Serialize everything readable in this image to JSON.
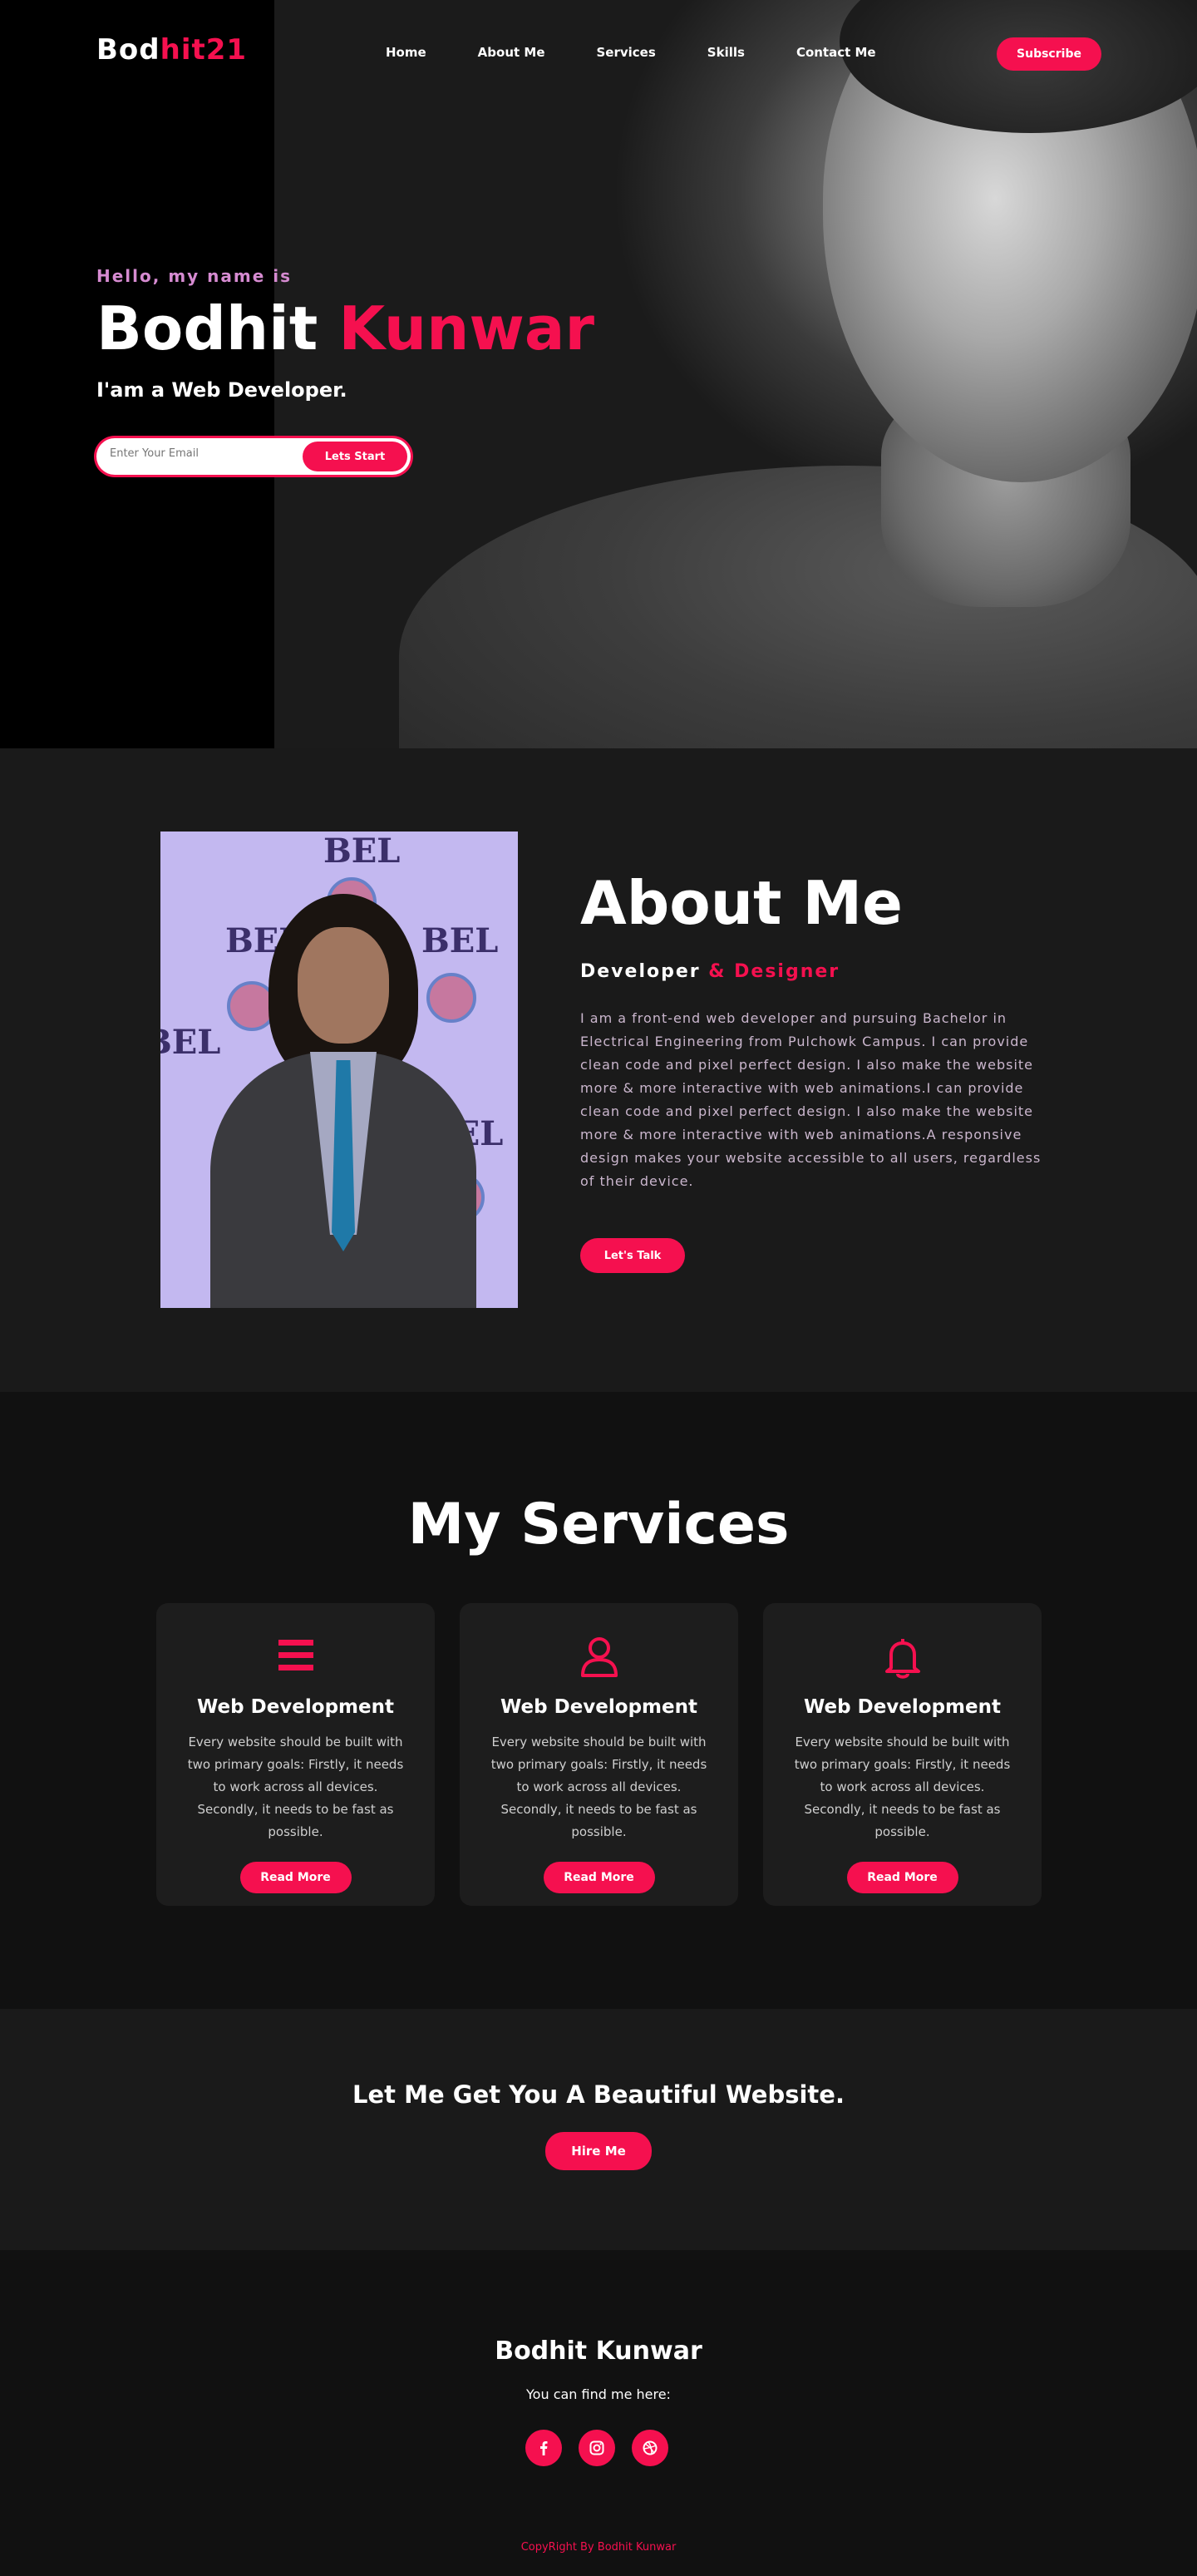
{
  "colors": {
    "accent": "#f5104f",
    "hello": "#d68bd1",
    "background": "#111111",
    "section_alt": "#1a1a1a"
  },
  "logo": {
    "prefix": "Bod",
    "accent": "hit21"
  },
  "nav": {
    "items": [
      "Home",
      "About Me",
      "Services",
      "Skills",
      "Contact Me"
    ],
    "subscribe_label": "Subscribe"
  },
  "hero": {
    "hello": "Hello, my name is",
    "first_name": "Bodhit",
    "last_name": "Kunwar",
    "tagline": "I'am a Web Developer.",
    "email_placeholder": "Enter Your Email",
    "start_label": "Lets Start"
  },
  "about": {
    "title": "About Me",
    "role_prefix": "Developer",
    "role_accent": "& Designer",
    "bio": "I am a front-end web developer and pursuing Bachelor in Electrical Engineering from Pulchowk Campus. I can provide clean code and pixel perfect design. I also make the website more & more interactive with web animations.I can provide clean code and pixel perfect design. I also make the website more & more interactive with web animations.A responsive design makes your website accessible to all users, regardless of their device.",
    "talk_label": "Let's Talk",
    "photo_banner": "BEL"
  },
  "services": {
    "title": "My Services",
    "cards": [
      {
        "icon": "menu-bars-icon",
        "title": "Web Development",
        "text": "Every website should be built with two primary goals: Firstly, it needs to work across all devices. Secondly, it needs to be fast as possible.",
        "button": "Read More"
      },
      {
        "icon": "user-icon",
        "title": "Web Development",
        "text": "Every website should be built with two primary goals: Firstly, it needs to work across all devices. Secondly, it needs to be fast as possible.",
        "button": "Read More"
      },
      {
        "icon": "bell-icon",
        "title": "Web Development",
        "text": "Every website should be built with two primary goals: Firstly, it needs to work across all devices. Secondly, it needs to be fast as possible.",
        "button": "Read More"
      }
    ]
  },
  "hire": {
    "title": "Let Me Get You A Beautiful Website.",
    "button": "Hire Me"
  },
  "footer": {
    "name": "Bodhit Kunwar",
    "find_me": "You can find me here:",
    "socials": [
      "facebook-icon",
      "instagram-icon",
      "dribbble-icon"
    ],
    "copyright": "CopyRight By Bodhit Kunwar"
  }
}
